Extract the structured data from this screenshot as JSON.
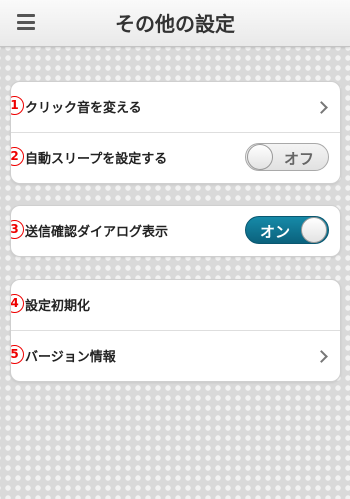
{
  "header": {
    "title": "その他の設定",
    "menu_icon": "hamburger-menu-icon"
  },
  "group1": {
    "items": [
      {
        "num": "1",
        "label": "クリック音を変える",
        "control": "chevron"
      },
      {
        "num": "2",
        "label": "自動スリープを設定する",
        "control": "toggle",
        "state": "off",
        "toggle_text": "オフ"
      }
    ]
  },
  "group2": {
    "items": [
      {
        "num": "3",
        "label": "送信確認ダイアログ表示",
        "control": "toggle",
        "state": "on",
        "toggle_text": "オン"
      }
    ]
  },
  "group3": {
    "items": [
      {
        "num": "4",
        "label": "設定初期化",
        "control": "none"
      },
      {
        "num": "5",
        "label": "バージョン情報",
        "control": "chevron"
      }
    ]
  },
  "colors": {
    "toggle_on": "#0f7894",
    "annotation_red": "#ee0000"
  }
}
